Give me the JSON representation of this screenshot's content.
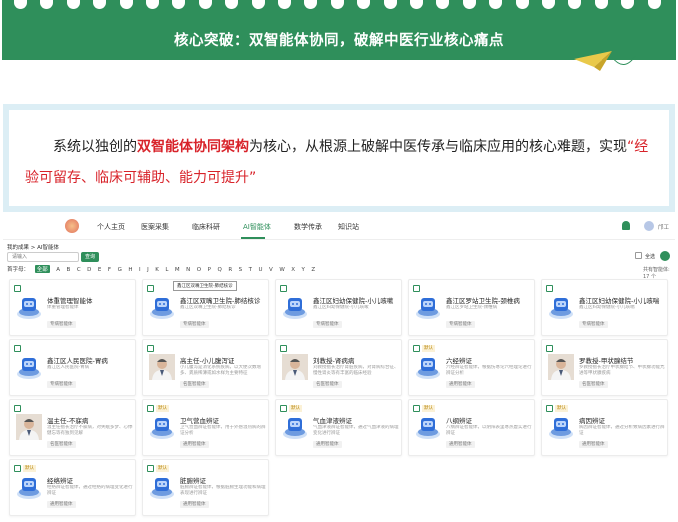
{
  "banner": {
    "title": "核心突破：双智能体协同，破解中医行业核心痛点"
  },
  "intro": {
    "part1": "系统以独创的",
    "highlight": "双智能体协同架构",
    "part2": "为核心，从根源上破解中医传承与临床应用的核心难题，实现",
    "quote": "“经验可留存、临床可辅助、能力可提升”"
  },
  "app": {
    "nav": [
      "个人主页",
      "医案采集",
      "临床科研",
      "AI智能体",
      "数学传承",
      "知识站"
    ],
    "active_nav_index": 3,
    "user_name": "邝工",
    "breadcrumb": "我的成果 > AI智能体",
    "search_placeholder": "请输入",
    "search_button": "查询",
    "select_all_label": "全选",
    "first_letter_label": "首字母：",
    "letters": [
      "全部",
      "A",
      "B",
      "C",
      "D",
      "E",
      "F",
      "G",
      "H",
      "I",
      "J",
      "K",
      "L",
      "M",
      "N",
      "O",
      "P",
      "Q",
      "R",
      "S",
      "T",
      "U",
      "V",
      "W",
      "X",
      "Y",
      "Z"
    ],
    "active_letter": "全部",
    "total_count": "共有智能体: 17 个",
    "tooltip": "鑫江区双嘴卫生院-肺结核诊",
    "cards": [
      {
        "name": "体重管理智能体",
        "desc": "体重管理智能体",
        "tag": "专病智能体",
        "type": "robot",
        "badge": ""
      },
      {
        "name": "鑫江区双嘴卫生院-肺结核诊",
        "desc": "鑫江区双嘴卫生院-肺结核诊",
        "tag": "专病智能体",
        "type": "robot",
        "badge": ""
      },
      {
        "name": "鑫江区妇幼保健院-小儿咳嗽",
        "desc": "鑫江区妇幼保健院-小儿咳嗽",
        "tag": "专病智能体",
        "type": "robot",
        "badge": ""
      },
      {
        "name": "鑫江区罗站卫生院-颈椎病",
        "desc": "鑫江区罗站卫生院-颈椎病",
        "tag": "专病智能体",
        "type": "robot",
        "badge": ""
      },
      {
        "name": "鑫江区妇幼保健院-小儿咳喘",
        "desc": "鑫江区妇幼保健院-小儿咳喘",
        "tag": "专病智能体",
        "type": "robot",
        "badge": ""
      },
      {
        "name": "鑫江区人民医院-胃病",
        "desc": "鑫江区人民医院-胃病",
        "tag": "专病智能体",
        "type": "robot",
        "badge": ""
      },
      {
        "name": "高主任-小儿腹泻证",
        "desc": "小儿腹泻是消化系统疾病，以大便次数增多、粪质稀薄或如水样为主要特征",
        "tag": "名医智能体",
        "type": "doctor",
        "badge": ""
      },
      {
        "name": "刘教授-肾病病",
        "desc": "刘教授擅长治疗肾脏疾病，对肾病综合征、慢性肾炎等有丰富的临床经验",
        "tag": "名医智能体",
        "type": "doctor",
        "badge": ""
      },
      {
        "name": "六经辨证",
        "desc": "六经辨证智能体，根据伤寒论六经理论进行辨证分析",
        "tag": "通用智能体",
        "type": "robot",
        "badge": "默认"
      },
      {
        "name": "罗教授-甲状腺结节",
        "desc": "罗教授擅长治疗甲状腺结节、甲状腺功能亢进等甲状腺疾病",
        "tag": "名医智能体",
        "type": "doctor",
        "badge": ""
      },
      {
        "name": "温主任-不寐病",
        "desc": "温主任擅长治疗不寐病，对失眠多梦、心悸健忘等有独到见解",
        "tag": "名医智能体",
        "type": "doctor",
        "badge": ""
      },
      {
        "name": "卫气营血辨证",
        "desc": "卫气营血辨证智能体，用于外感温热病的辨证分析",
        "tag": "通用智能体",
        "type": "robot",
        "badge": "默认"
      },
      {
        "name": "气血津液辨证",
        "desc": "气血津液辨证智能体，通过气血津液的病理变化进行辨证",
        "tag": "通用智能体",
        "type": "robot",
        "badge": "默认"
      },
      {
        "name": "八纲辨证",
        "desc": "八纲辨证智能体，以阴阳表里寒热虚实进行辨证",
        "tag": "通用智能体",
        "type": "robot",
        "badge": "默认"
      },
      {
        "name": "病因辨证",
        "desc": "病因辨证智能体，通过分析致病因素进行辨证",
        "tag": "通用智能体",
        "type": "robot",
        "badge": "默认"
      },
      {
        "name": "经络辨证",
        "desc": "经络辨证智能体，通过经络的病理变化进行辨证",
        "tag": "通用智能体",
        "type": "robot",
        "badge": "默认"
      },
      {
        "name": "脏腑辨证",
        "desc": "脏腑辨证智能体，根据脏腑生理功能和病理表现进行辨证",
        "tag": "通用智能体",
        "type": "robot",
        "badge": "默认"
      }
    ]
  },
  "colors": {
    "brand_green": "#2f8f5b",
    "highlight_red": "#d8232a"
  }
}
